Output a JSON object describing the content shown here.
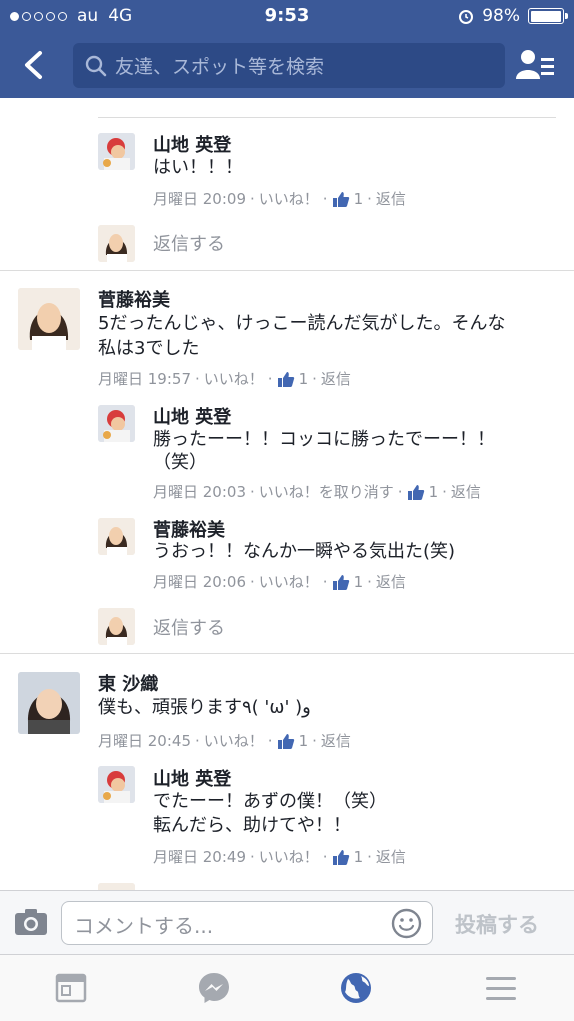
{
  "status": {
    "carrier": "au",
    "network": "4G",
    "time": "9:53",
    "battery": "98%",
    "battery_level": 0.98
  },
  "nav": {
    "search_placeholder": "友達、スポット等を検索"
  },
  "comments": [
    {
      "replies": [
        {
          "name": "山地 英登",
          "text": "はい！！！",
          "time": "月曜日 20:09",
          "like": "いいね！",
          "count": "1",
          "reply": "返信"
        }
      ],
      "reply_prompt": "返信する"
    },
    {
      "name": "菅藤裕美",
      "text_lines": [
        "5だったんじゃ、けっこー読んだ気がした。そんな",
        "私は3でした"
      ],
      "time": "月曜日 19:57",
      "like": "いいね！",
      "count": "1",
      "reply": "返信",
      "replies": [
        {
          "name": "山地 英登",
          "text_lines": [
            "勝ったーー！！コッコに勝ったでーー！！",
            "（笑）"
          ],
          "time": "月曜日 20:03",
          "like": "いいね！を取り消す",
          "count": "1",
          "reply": "返信"
        },
        {
          "name": "菅藤裕美",
          "text": "うおっ！！なんか一瞬やる気出た(笑)",
          "time": "月曜日 20:06",
          "like": "いいね！",
          "count": "1",
          "reply": "返信"
        }
      ],
      "reply_prompt": "返信する"
    },
    {
      "name": "東 沙織",
      "text": "僕も、頑張ります٩( 'ω' )و",
      "time": "月曜日 20:45",
      "like": "いいね！",
      "count": "1",
      "reply": "返信",
      "replies": [
        {
          "name": "山地 英登",
          "text_lines": [
            "でたーー！あずの僕！（笑）",
            "転んだら、助けてや！！"
          ],
          "time": "月曜日 20:49",
          "like": "いいね！",
          "count": "1",
          "reply": "返信"
        }
      ]
    }
  ],
  "composer": {
    "placeholder": "コメントする...",
    "post_label": "投稿する"
  },
  "tabs": [
    "news-feed",
    "messenger",
    "notifications",
    "menu"
  ],
  "colors": {
    "brand": "#3b5998",
    "link_blue": "#4267b2",
    "meta_gray": "#90949c"
  }
}
